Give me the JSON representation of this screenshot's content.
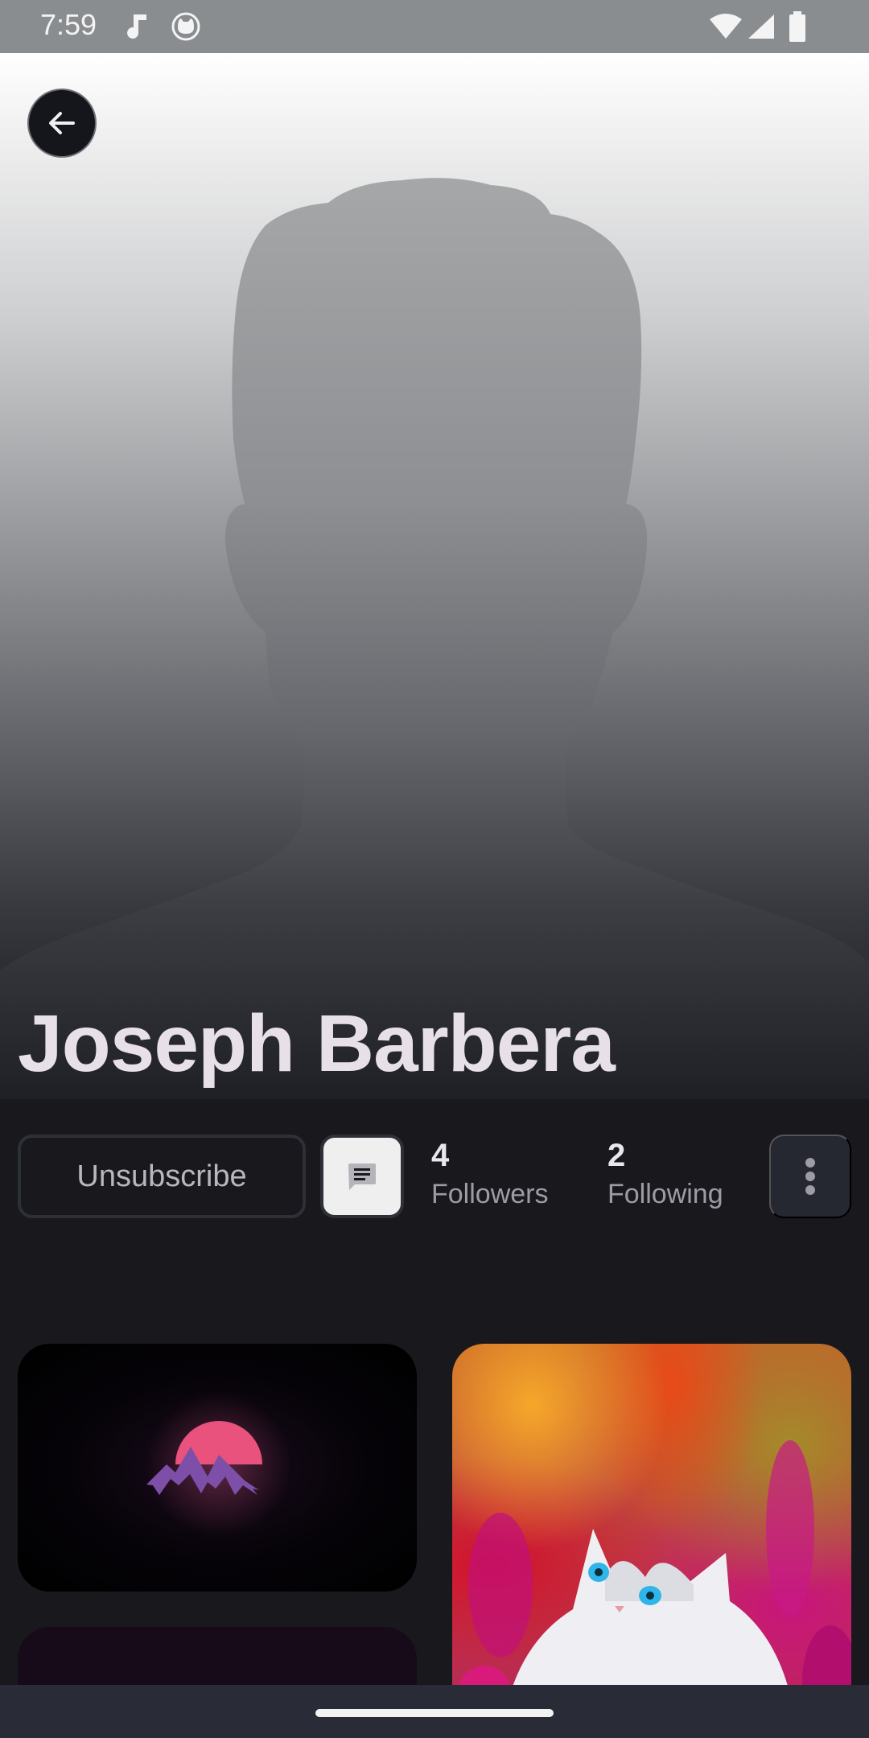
{
  "status_bar": {
    "time": "7:59",
    "icons_left": [
      "music-note-icon",
      "cat-face-icon"
    ],
    "icons_right": [
      "wifi-icon",
      "cell-signal-icon",
      "battery-icon"
    ]
  },
  "profile": {
    "name": "Joseph Barbera",
    "followers_count": "4",
    "followers_label": "Followers",
    "following_count": "2",
    "following_label": "Following"
  },
  "actions": {
    "back_icon": "arrow-left-icon",
    "unsubscribe_label": "Unsubscribe",
    "message_icon": "chat-bubble-icon",
    "more_icon": "more-vertical-icon"
  },
  "posts": [
    {
      "image": "mountain-logo"
    },
    {
      "image": "white-kitten"
    },
    {
      "image": "dark-purple"
    }
  ],
  "colors": {
    "background": "#18181d",
    "outline": "#2e3038",
    "name_text": "#e7e0e8",
    "secondary_text": "#9d9ca5"
  }
}
